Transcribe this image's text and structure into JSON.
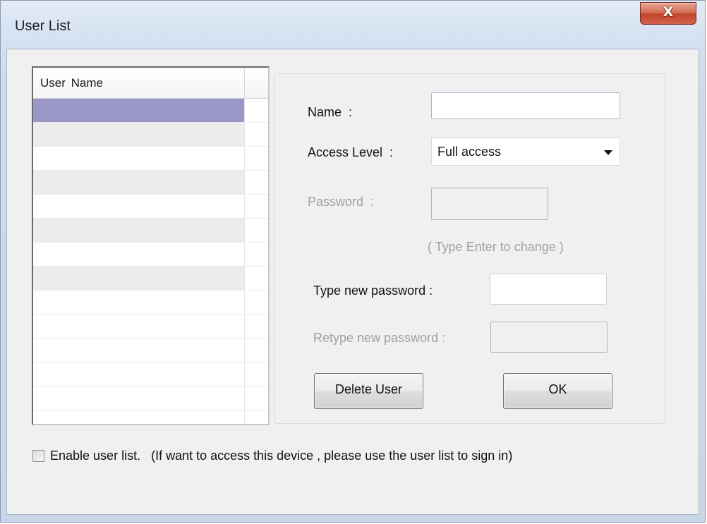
{
  "window": {
    "title": "User List",
    "close_glyph": "X"
  },
  "user_list": {
    "column_header": "User  Name",
    "rows": [
      {
        "name": "",
        "state": "selected"
      },
      {
        "name": "",
        "state": "gray"
      },
      {
        "name": "",
        "state": "white"
      },
      {
        "name": "",
        "state": "gray"
      },
      {
        "name": "",
        "state": "white"
      },
      {
        "name": "",
        "state": "gray"
      },
      {
        "name": "",
        "state": "white"
      },
      {
        "name": "",
        "state": "gray"
      },
      {
        "name": "",
        "state": "white"
      },
      {
        "name": "",
        "state": "white"
      },
      {
        "name": "",
        "state": "white"
      },
      {
        "name": "",
        "state": "white"
      },
      {
        "name": "",
        "state": "white"
      },
      {
        "name": "",
        "state": "white"
      }
    ]
  },
  "form": {
    "name_label": "Name  :",
    "name_value": "",
    "access_level_label": "Access Level  :",
    "access_level_value": "Full access",
    "password_label": "Password  :",
    "password_value": "",
    "password_hint": "( Type Enter to change )",
    "new_password_label": "Type new password :",
    "new_password_value": "",
    "retype_password_label": "Retype new password :",
    "retype_password_value": ""
  },
  "buttons": {
    "delete_user": "Delete User",
    "ok": "OK"
  },
  "enable_list": {
    "checked": false,
    "label": "Enable user list.   (If want to access this device , please use the user list to sign in)"
  },
  "icons": {
    "close": "close-icon",
    "dropdown": "chevron-down-icon"
  },
  "colors": {
    "selected_row": "#9a96c8",
    "close_button": "#c4432a"
  }
}
